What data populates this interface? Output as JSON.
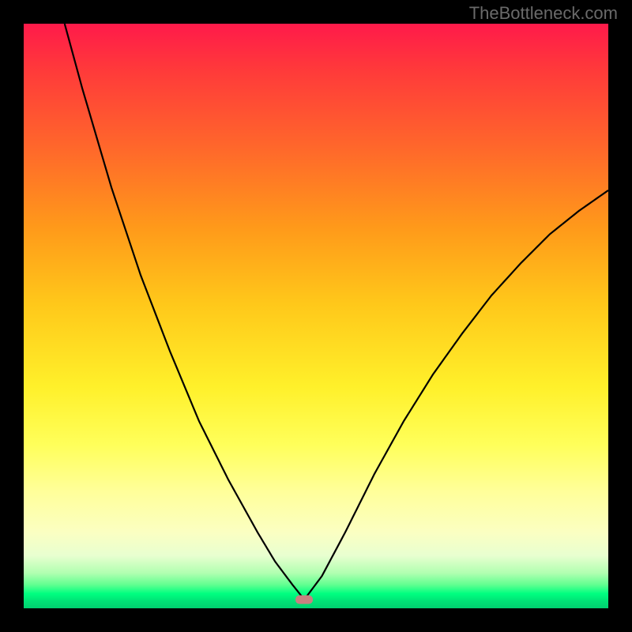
{
  "watermark": "TheBottleneck.com",
  "chart_data": {
    "type": "line",
    "title": "",
    "xlabel": "",
    "ylabel": "",
    "xlim": [
      0,
      1
    ],
    "ylim": [
      0,
      1
    ],
    "grid": false,
    "legend": false,
    "annotations": [
      {
        "type": "marker",
        "x": 0.48,
        "y": 0.985,
        "label": "minimum"
      }
    ],
    "gradient_stops": [
      {
        "pos": 0.0,
        "color": "#ff1a4a"
      },
      {
        "pos": 0.35,
        "color": "#ff9a1a"
      },
      {
        "pos": 0.62,
        "color": "#fff02a"
      },
      {
        "pos": 0.87,
        "color": "#fbffc2"
      },
      {
        "pos": 0.96,
        "color": "#60ff90"
      },
      {
        "pos": 1.0,
        "color": "#00d070"
      }
    ],
    "series": [
      {
        "name": "left-branch",
        "x": [
          0.07,
          0.1,
          0.15,
          0.2,
          0.25,
          0.3,
          0.35,
          0.4,
          0.43,
          0.46,
          0.48
        ],
        "y": [
          0.0,
          0.11,
          0.28,
          0.43,
          0.56,
          0.68,
          0.78,
          0.87,
          0.92,
          0.96,
          0.985
        ]
      },
      {
        "name": "right-branch",
        "x": [
          0.48,
          0.51,
          0.55,
          0.6,
          0.65,
          0.7,
          0.75,
          0.8,
          0.85,
          0.9,
          0.95,
          1.0
        ],
        "y": [
          0.985,
          0.945,
          0.87,
          0.77,
          0.68,
          0.6,
          0.53,
          0.465,
          0.41,
          0.36,
          0.32,
          0.285
        ]
      }
    ],
    "minimum": {
      "x": 0.48,
      "y": 0.985
    }
  }
}
